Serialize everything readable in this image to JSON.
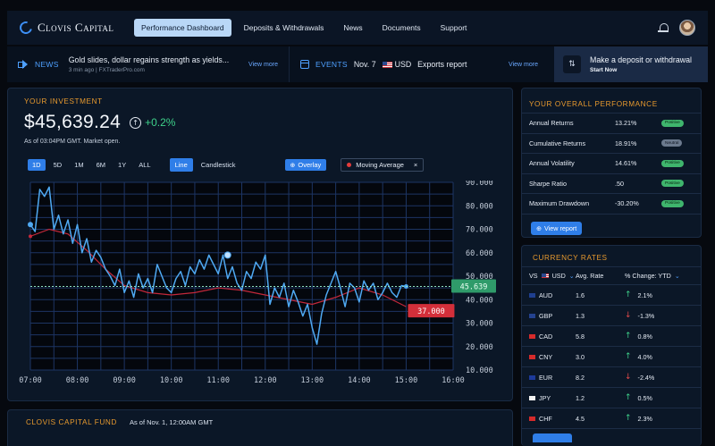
{
  "brand": {
    "name": "Clovis Capital"
  },
  "nav": {
    "tabs": [
      {
        "label": "Performance Dashboard",
        "active": true
      },
      {
        "label": "Deposits & Withdrawals"
      },
      {
        "label": "News"
      },
      {
        "label": "Documents"
      },
      {
        "label": "Support"
      }
    ]
  },
  "news": {
    "label": "NEWS",
    "headline": "Gold slides, dollar regains strength as yields...",
    "meta": "3 min ago  |  FXTraderPro.com",
    "view_more": "View more"
  },
  "events": {
    "label": "EVENTS",
    "date": "Nov. 7",
    "currency": "USD",
    "text": "Exports report",
    "view_more": "View more"
  },
  "deposit": {
    "title": "Make a deposit or withdrawal",
    "subtitle": "Start Now",
    "icon": "swap-arrows-icon"
  },
  "investment": {
    "title": "YOUR INVESTMENT",
    "value": "$45,639.24",
    "change": "+0.2%",
    "as_of": "As of 03:04PM GMT. Market open.",
    "ranges": [
      "1D",
      "5D",
      "1M",
      "6M",
      "1Y",
      "ALL"
    ],
    "active_range": "1D",
    "chart_types": [
      "Line",
      "Candlestick"
    ],
    "active_chart_type": "Line",
    "overlay_label": "Overlay",
    "moving_average_label": "Moving Average",
    "remove_label": "×"
  },
  "chart_data": {
    "type": "line",
    "x_ticks": [
      "07:00",
      "08:00",
      "09:00",
      "10:00",
      "11:00",
      "12:00",
      "13:00",
      "14:00",
      "15:00",
      "16:00"
    ],
    "y_ticks": [
      "90.000",
      "80.000",
      "70.000",
      "60.000",
      "50.000",
      "40.000",
      "30.000",
      "20.000",
      "10.000"
    ],
    "xlim": [
      7,
      16
    ],
    "ylim": [
      10,
      90
    ],
    "grid": true,
    "colors": {
      "price": "#4fa9f2",
      "moving_average": "#c3283a",
      "current_line": "#8fe0c0"
    },
    "current_price_label": "45.639",
    "moving_average_label_value": "37.000",
    "series": [
      {
        "values": [
          [
            7.0,
            72
          ],
          [
            7.1,
            69
          ],
          [
            7.2,
            87
          ],
          [
            7.3,
            84
          ],
          [
            7.4,
            88
          ],
          [
            7.5,
            70
          ],
          [
            7.6,
            76
          ],
          [
            7.7,
            68
          ],
          [
            7.8,
            74
          ],
          [
            7.9,
            64
          ],
          [
            8.0,
            72
          ],
          [
            8.1,
            60
          ],
          [
            8.2,
            66
          ],
          [
            8.3,
            56
          ],
          [
            8.4,
            61
          ],
          [
            8.5,
            58
          ],
          [
            8.6,
            53
          ],
          [
            8.7,
            50
          ],
          [
            8.8,
            46
          ],
          [
            8.9,
            53
          ],
          [
            9.0,
            43
          ],
          [
            9.1,
            48
          ],
          [
            9.2,
            41
          ],
          [
            9.3,
            51
          ],
          [
            9.4,
            45
          ],
          [
            9.5,
            49
          ],
          [
            9.6,
            43
          ],
          [
            9.7,
            55
          ],
          [
            9.8,
            50
          ],
          [
            9.9,
            45
          ],
          [
            10.0,
            43
          ],
          [
            10.1,
            49
          ],
          [
            10.2,
            52
          ],
          [
            10.3,
            46
          ],
          [
            10.4,
            54
          ],
          [
            10.5,
            51
          ],
          [
            10.6,
            57
          ],
          [
            10.7,
            53
          ],
          [
            10.8,
            59
          ],
          [
            10.9,
            55
          ],
          [
            11.0,
            51
          ],
          [
            11.1,
            59
          ],
          [
            11.2,
            49
          ],
          [
            11.3,
            54
          ],
          [
            11.4,
            47
          ],
          [
            11.5,
            44
          ],
          [
            11.6,
            52
          ],
          [
            11.7,
            49
          ],
          [
            11.8,
            56
          ],
          [
            11.9,
            53
          ],
          [
            12.0,
            59
          ],
          [
            12.1,
            38
          ],
          [
            12.2,
            45
          ],
          [
            12.3,
            41
          ],
          [
            12.4,
            47
          ],
          [
            12.5,
            37
          ],
          [
            12.6,
            44
          ],
          [
            12.7,
            39
          ],
          [
            12.8,
            33
          ],
          [
            12.9,
            38
          ],
          [
            13.0,
            28
          ],
          [
            13.1,
            21
          ],
          [
            13.2,
            34
          ],
          [
            13.3,
            42
          ],
          [
            13.4,
            47
          ],
          [
            13.5,
            52
          ],
          [
            13.6,
            45
          ],
          [
            13.7,
            37
          ],
          [
            13.8,
            47
          ],
          [
            13.9,
            45
          ],
          [
            14.0,
            39
          ],
          [
            14.1,
            48
          ],
          [
            14.2,
            44
          ],
          [
            14.3,
            47
          ],
          [
            14.4,
            40
          ],
          [
            14.5,
            43
          ],
          [
            14.6,
            47
          ],
          [
            14.7,
            43
          ],
          [
            14.8,
            41
          ],
          [
            14.9,
            46
          ],
          [
            15.0,
            45.6
          ]
        ]
      },
      {
        "values": [
          [
            7.0,
            67
          ],
          [
            7.4,
            70
          ],
          [
            7.8,
            68
          ],
          [
            8.2,
            61
          ],
          [
            8.6,
            53
          ],
          [
            9.0,
            46
          ],
          [
            9.5,
            43
          ],
          [
            10.0,
            42
          ],
          [
            10.5,
            43
          ],
          [
            11.0,
            45
          ],
          [
            11.5,
            44
          ],
          [
            12.0,
            42
          ],
          [
            12.5,
            40
          ],
          [
            13.0,
            38
          ],
          [
            13.5,
            41
          ],
          [
            14.0,
            45
          ],
          [
            14.5,
            42
          ],
          [
            14.8,
            39
          ],
          [
            15.0,
            37
          ]
        ]
      }
    ]
  },
  "performance": {
    "title": "YOUR OVERALL PERFORMANCE",
    "rows": [
      {
        "label": "Annual Returns",
        "value": "13.21%",
        "badge": "Positive",
        "kind": "pos"
      },
      {
        "label": "Cumulative Returns",
        "value": "18.91%",
        "badge": "Neutral",
        "kind": "neu"
      },
      {
        "label": "Annual Volatility",
        "value": "14.61%",
        "badge": "Positive",
        "kind": "pos"
      },
      {
        "label": "Sharpe Ratio",
        "value": ".50",
        "badge": "Positive",
        "kind": "pos"
      },
      {
        "label": "Maximum Drawdown",
        "value": "-30.20%",
        "badge": "Positive",
        "kind": "pos"
      }
    ],
    "view_report": "View report"
  },
  "currency": {
    "title": "CURRENCY RATES",
    "base_label": "VS",
    "base_currency": "USD",
    "col_avg": "Avg. Rate",
    "col_change": "% Change: YTD",
    "rows": [
      {
        "code": "AUD",
        "rate": "1.6",
        "change": "2.1%",
        "dir": "up",
        "flag": "#1f3f8f"
      },
      {
        "code": "GBP",
        "rate": "1.3",
        "change": "-1.3%",
        "dir": "down",
        "flag": "#24428f"
      },
      {
        "code": "CAD",
        "rate": "5.8",
        "change": "0.8%",
        "dir": "up",
        "flag": "#d52b2b"
      },
      {
        "code": "CNY",
        "rate": "3.0",
        "change": "4.0%",
        "dir": "up",
        "flag": "#d52b2b"
      },
      {
        "code": "EUR",
        "rate": "8.2",
        "change": "-2.4%",
        "dir": "down",
        "flag": "#1d3a9a"
      },
      {
        "code": "JPY",
        "rate": "1.2",
        "change": "0.5%",
        "dir": "up",
        "flag": "#f2f2f2"
      },
      {
        "code": "CHF",
        "rate": "4.5",
        "change": "2.3%",
        "dir": "up",
        "flag": "#d52b2b"
      }
    ]
  },
  "fund": {
    "title": "CLOVIS CAPITAL FUND",
    "as_of": "As of Nov. 1, 12:00AM GMT"
  }
}
